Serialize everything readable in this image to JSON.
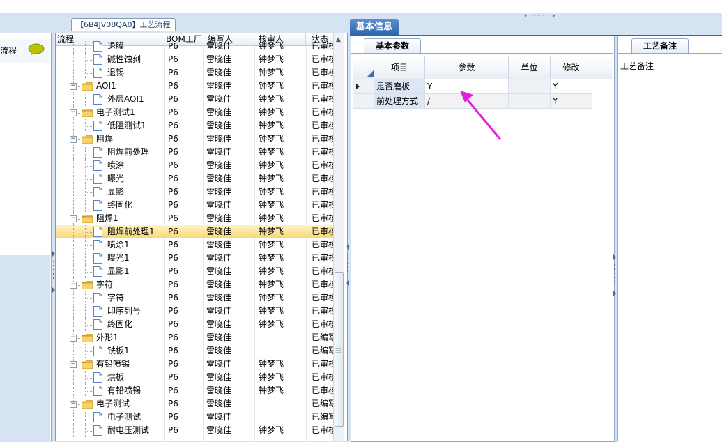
{
  "colors": {
    "accent": "#2e66b0",
    "selected_row": "#f7d774",
    "folder": "#e8b03a",
    "arrow": "#e020e0"
  },
  "left_panel": {
    "title": "流程",
    "chat_icon": "speech-bubble-icon"
  },
  "tree_panel": {
    "tab_label": "【6B4JV08QA0】工艺流程",
    "columns": [
      "流程",
      "BOM工厂",
      "编写人",
      "核审人",
      "状态"
    ],
    "rows": [
      {
        "name": "退膜",
        "level": 1,
        "type": "doc",
        "factory": "P6",
        "writer": "雷晓佳",
        "reviewer": "钟梦飞",
        "status": "已审核"
      },
      {
        "name": "碱性蚀刻",
        "level": 1,
        "type": "doc",
        "factory": "P6",
        "writer": "雷晓佳",
        "reviewer": "钟梦飞",
        "status": "已审核"
      },
      {
        "name": "退锡",
        "level": 1,
        "type": "doc",
        "factory": "P6",
        "writer": "雷晓佳",
        "reviewer": "钟梦飞",
        "status": "已审核"
      },
      {
        "name": "AOI1",
        "level": 0,
        "type": "folder",
        "factory": "P6",
        "writer": "雷晓佳",
        "reviewer": "钟梦飞",
        "status": "已审核"
      },
      {
        "name": "外层AOI1",
        "level": 1,
        "type": "doc",
        "factory": "P6",
        "writer": "雷晓佳",
        "reviewer": "钟梦飞",
        "status": "已审核"
      },
      {
        "name": "电子测试1",
        "level": 0,
        "type": "folder",
        "factory": "P6",
        "writer": "雷晓佳",
        "reviewer": "钟梦飞",
        "status": "已审核"
      },
      {
        "name": "低阻测试1",
        "level": 1,
        "type": "doc",
        "factory": "P6",
        "writer": "雷晓佳",
        "reviewer": "钟梦飞",
        "status": "已审核"
      },
      {
        "name": "阻焊",
        "level": 0,
        "type": "folder",
        "factory": "P6",
        "writer": "雷晓佳",
        "reviewer": "钟梦飞",
        "status": "已审核"
      },
      {
        "name": "阻焊前处理",
        "level": 1,
        "type": "doc",
        "factory": "P6",
        "writer": "雷晓佳",
        "reviewer": "钟梦飞",
        "status": "已审核"
      },
      {
        "name": "喷涂",
        "level": 1,
        "type": "doc",
        "factory": "P6",
        "writer": "雷晓佳",
        "reviewer": "钟梦飞",
        "status": "已审核"
      },
      {
        "name": "曝光",
        "level": 1,
        "type": "doc",
        "factory": "P6",
        "writer": "雷晓佳",
        "reviewer": "钟梦飞",
        "status": "已审核"
      },
      {
        "name": "显影",
        "level": 1,
        "type": "doc",
        "factory": "P6",
        "writer": "雷晓佳",
        "reviewer": "钟梦飞",
        "status": "已审核"
      },
      {
        "name": "终固化",
        "level": 1,
        "type": "doc",
        "factory": "P6",
        "writer": "雷晓佳",
        "reviewer": "钟梦飞",
        "status": "已审核"
      },
      {
        "name": "阻焊1",
        "level": 0,
        "type": "folder",
        "factory": "P6",
        "writer": "雷晓佳",
        "reviewer": "钟梦飞",
        "status": "已审核"
      },
      {
        "name": "阻焊前处理1",
        "level": 1,
        "type": "doc",
        "factory": "P6",
        "writer": "雷晓佳",
        "reviewer": "钟梦飞",
        "status": "已审核",
        "selected": true
      },
      {
        "name": "喷涂1",
        "level": 1,
        "type": "doc",
        "factory": "P6",
        "writer": "雷晓佳",
        "reviewer": "钟梦飞",
        "status": "已审核"
      },
      {
        "name": "曝光1",
        "level": 1,
        "type": "doc",
        "factory": "P6",
        "writer": "雷晓佳",
        "reviewer": "钟梦飞",
        "status": "已审核"
      },
      {
        "name": "显影1",
        "level": 1,
        "type": "doc",
        "factory": "P6",
        "writer": "雷晓佳",
        "reviewer": "钟梦飞",
        "status": "已审核"
      },
      {
        "name": "字符",
        "level": 0,
        "type": "folder",
        "factory": "P6",
        "writer": "雷晓佳",
        "reviewer": "钟梦飞",
        "status": "已审核"
      },
      {
        "name": "字符",
        "level": 1,
        "type": "doc",
        "factory": "P6",
        "writer": "雷晓佳",
        "reviewer": "钟梦飞",
        "status": "已审核"
      },
      {
        "name": "印序列号",
        "level": 1,
        "type": "doc",
        "factory": "P6",
        "writer": "雷晓佳",
        "reviewer": "钟梦飞",
        "status": "已审核"
      },
      {
        "name": "终固化",
        "level": 1,
        "type": "doc",
        "factory": "P6",
        "writer": "雷晓佳",
        "reviewer": "钟梦飞",
        "status": "已审核"
      },
      {
        "name": "外形1",
        "level": 0,
        "type": "folder",
        "factory": "P6",
        "writer": "雷晓佳",
        "reviewer": "",
        "status": "已编写"
      },
      {
        "name": "铣板1",
        "level": 1,
        "type": "doc",
        "factory": "P6",
        "writer": "雷晓佳",
        "reviewer": "",
        "status": "已编写"
      },
      {
        "name": "有铅喷锡",
        "level": 0,
        "type": "folder",
        "factory": "P6",
        "writer": "雷晓佳",
        "reviewer": "钟梦飞",
        "status": "已审核"
      },
      {
        "name": "烘板",
        "level": 1,
        "type": "doc",
        "factory": "P6",
        "writer": "雷晓佳",
        "reviewer": "钟梦飞",
        "status": "已审核"
      },
      {
        "name": "有铅喷锡",
        "level": 1,
        "type": "doc",
        "factory": "P6",
        "writer": "雷晓佳",
        "reviewer": "钟梦飞",
        "status": "已审核"
      },
      {
        "name": "电子测试",
        "level": 0,
        "type": "folder",
        "factory": "P6",
        "writer": "雷晓佳",
        "reviewer": "",
        "status": "已编写"
      },
      {
        "name": "电子测试",
        "level": 1,
        "type": "doc",
        "factory": "P6",
        "writer": "雷晓佳",
        "reviewer": "",
        "status": "已编写"
      },
      {
        "name": "耐电压测试",
        "level": 1,
        "type": "doc",
        "factory": "P6",
        "writer": "雷晓佳",
        "reviewer": "钟梦飞",
        "status": "已审核"
      }
    ]
  },
  "basic_info": {
    "tab_label": "基本信息",
    "params_tab": "基本参数",
    "columns": [
      "项目",
      "参数",
      "单位",
      "修改"
    ],
    "rows": [
      {
        "item": "是否磨板",
        "param": "Y",
        "unit": "",
        "modified": "Y",
        "current": true
      },
      {
        "item": "前处理方式",
        "param": "/",
        "unit": "",
        "modified": "Y",
        "current": false
      }
    ]
  },
  "notes": {
    "tab_label": "工艺备注",
    "field_label": "工艺备注"
  }
}
